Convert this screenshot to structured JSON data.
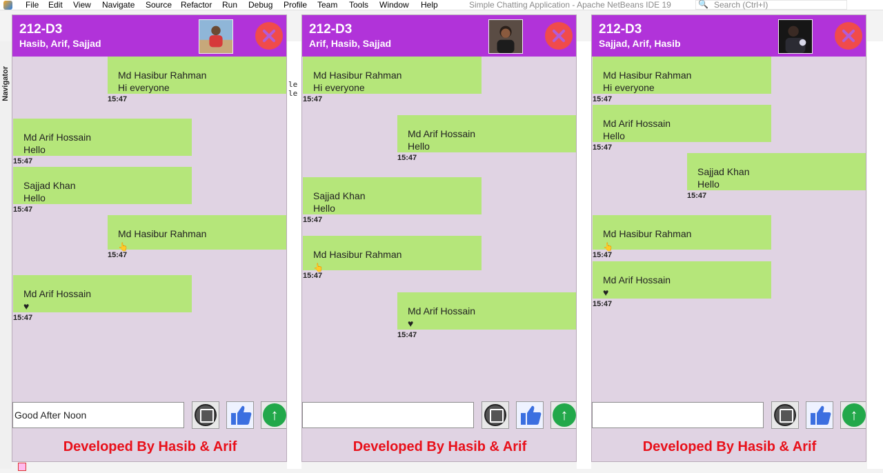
{
  "ide": {
    "menu": [
      "File",
      "Edit",
      "View",
      "Navigate",
      "Source",
      "Refactor",
      "Run",
      "Debug",
      "Profile",
      "Team",
      "Tools",
      "Window",
      "Help"
    ],
    "title": "Simple Chatting Application - Apache NetBeans IDE 19",
    "search_placeholder": "Search (Ctrl+I)",
    "navigator_label": "Navigator"
  },
  "windows": [
    {
      "group": "212-D3",
      "members": "Hasib, Arif, Sajjad",
      "input_value": "Good After Noon",
      "footer": "Developed By Hasib & Arif",
      "messages": [
        {
          "sender": "Md Hasibur Rahman",
          "text": "Hi everyone",
          "time": "15:47",
          "align": "right"
        },
        {
          "sender": "Md Arif Hossain",
          "text": "Hello",
          "time": "15:47",
          "align": "left"
        },
        {
          "sender": "Sajjad Khan",
          "text": "Hello",
          "time": "15:47",
          "align": "left"
        },
        {
          "sender": "Md Hasibur Rahman",
          "text": "👆",
          "time": "15:47",
          "align": "right"
        },
        {
          "sender": "Md Arif Hossain",
          "text": "♥",
          "time": "15:47",
          "align": "left"
        }
      ]
    },
    {
      "group": "212-D3",
      "members": "Arif, Hasib, Sajjad",
      "input_value": "",
      "footer": "Developed By Hasib & Arif",
      "messages": [
        {
          "sender": "Md Hasibur Rahman",
          "text": "Hi everyone",
          "time": "15:47",
          "align": "left"
        },
        {
          "sender": "Md Arif Hossain",
          "text": "Hello",
          "time": "15:47",
          "align": "right"
        },
        {
          "sender": "Sajjad Khan",
          "text": "Hello",
          "time": "15:47",
          "align": "left"
        },
        {
          "sender": "Md Hasibur Rahman",
          "text": "👆",
          "time": "15:47",
          "align": "left"
        },
        {
          "sender": "Md Arif Hossain",
          "text": "♥",
          "time": "15:47",
          "align": "right"
        }
      ]
    },
    {
      "group": "212-D3",
      "members": "Sajjad, Arif, Hasib",
      "input_value": "",
      "footer": "Developed By Hasib & Arif",
      "messages": [
        {
          "sender": "Md Hasibur Rahman",
          "text": "Hi everyone",
          "time": "15:47",
          "align": "left"
        },
        {
          "sender": "Md Arif Hossain",
          "text": "Hello",
          "time": "15:47",
          "align": "left"
        },
        {
          "sender": "Sajjad Khan",
          "text": "Hello",
          "time": "15:47",
          "align": "right"
        },
        {
          "sender": "Md Hasibur Rahman",
          "text": "👆",
          "time": "15:47",
          "align": "left"
        },
        {
          "sender": "Md Arif Hossain",
          "text": "♥",
          "time": "15:47",
          "align": "left"
        }
      ]
    }
  ],
  "colors": {
    "header": "#b133d9",
    "chat_bg": "#e0d3e3",
    "bubble": "#b5e67a",
    "close": "#f04b4b",
    "send": "#22a84a",
    "like": "#3b6fe0",
    "footer_text": "#e8101a"
  },
  "icons": [
    "close-icon",
    "attach-image-icon",
    "thumbs-up-icon",
    "send-arrow-icon",
    "search-icon"
  ]
}
